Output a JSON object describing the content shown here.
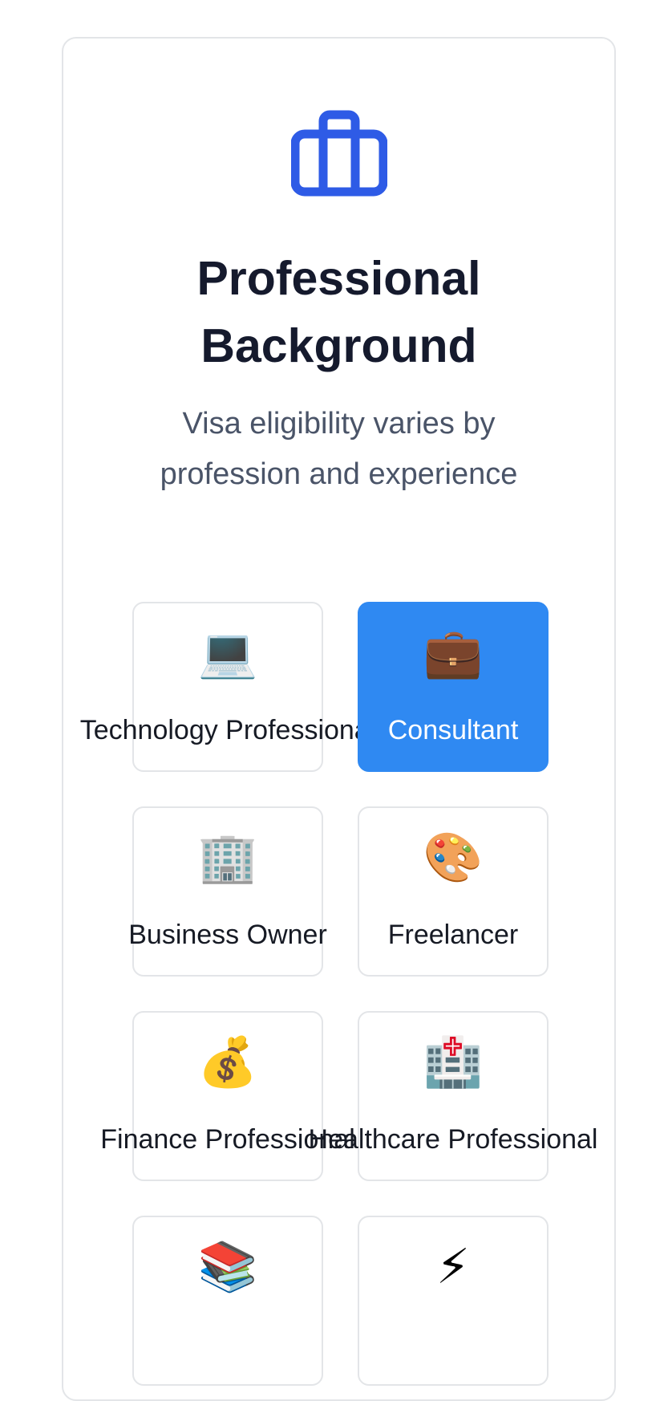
{
  "header": {
    "icon": "briefcase-icon",
    "title": "Professional Background",
    "subtitle": "Visa eligibility varies by profession and experience"
  },
  "colors": {
    "accent": "#2f89f2",
    "icon_blue": "#2e5be6",
    "title": "#151a2d",
    "subtitle": "#4a5468"
  },
  "options": [
    {
      "label": "Technology Professional",
      "emoji": "💻",
      "icon": "laptop-icon",
      "selected": false
    },
    {
      "label": "Consultant",
      "emoji": "💼",
      "icon": "briefcase-emoji-icon",
      "selected": true
    },
    {
      "label": "Business Owner",
      "emoji": "🏢",
      "icon": "office-building-icon",
      "selected": false
    },
    {
      "label": "Freelancer",
      "emoji": "🎨",
      "icon": "palette-icon",
      "selected": false
    },
    {
      "label": "Finance Professional",
      "emoji": "💰",
      "icon": "money-bag-icon",
      "selected": false
    },
    {
      "label": "Healthcare Professional",
      "emoji": "🏥",
      "icon": "hospital-icon",
      "selected": false
    },
    {
      "label": "",
      "emoji": "📚",
      "icon": "books-icon",
      "selected": false
    },
    {
      "label": "",
      "emoji": "⚡",
      "icon": "lightning-icon",
      "selected": false
    }
  ]
}
